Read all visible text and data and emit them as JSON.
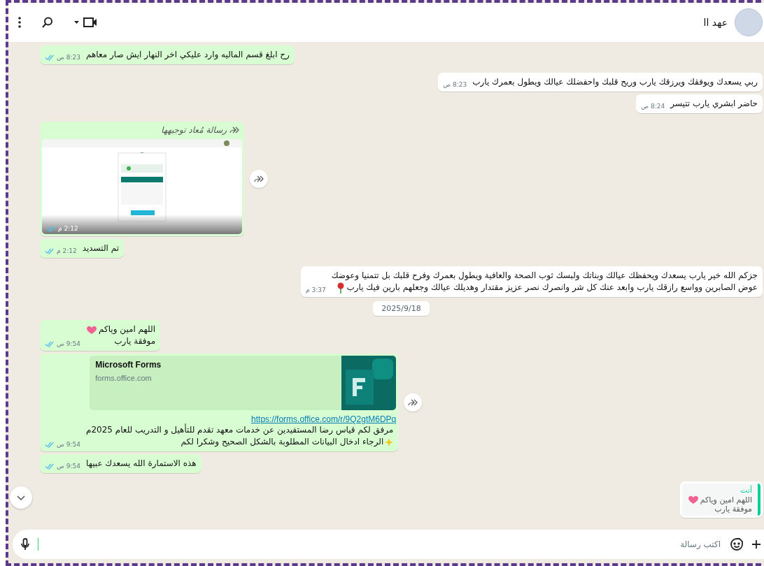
{
  "header": {
    "name": "عهد اا"
  },
  "messages": [
    {
      "kind": "text",
      "outgoing": true,
      "lines": [
        {
          "text": "رح ابلغ قسم الماليه وارد عليكي اخر النهار ايش صار معاهم"
        }
      ],
      "time": "8:23 ص",
      "read": true
    },
    {
      "kind": "text",
      "outgoing": false,
      "lines": [
        {
          "text": "ربي يسعدك ويوفقك ويرزقك يارب وريح قلبك واحفضلك عيالك ويطول بعمرك يارب"
        }
      ],
      "time": "8:23 ص"
    },
    {
      "kind": "text",
      "outgoing": false,
      "lines": [
        {
          "text": "حاضر ابشري يارب تتيسر"
        }
      ],
      "time": "8:24 ص"
    },
    {
      "kind": "image",
      "outgoing": true,
      "forwarded_label": "رسالة مُعاد توجيهها",
      "time": "2:12 م",
      "read": true
    },
    {
      "kind": "text",
      "outgoing": true,
      "lines": [
        {
          "text": "تم التسديد"
        }
      ],
      "time": "2:12 م",
      "read": true
    },
    {
      "kind": "text",
      "outgoing": false,
      "lines": [
        {
          "text": "جزكم الله خير يارب يسعدك ويحفظك عيالك وبناتك ولبسك ثوب الصحة والعافية ويطول بعمرك وفرح قلبك بل تتمنيا وعوضك"
        },
        {
          "text": "عوض الصابرين وواسع رازقك يارب وابعد عنك كل شر وانصرك نصر عزيز مقتدار وهديلك عيالك وجعلهم بارين فيك يارب",
          "emoji": {
            "kind": "rose"
          }
        }
      ],
      "time": "3:37 م"
    },
    {
      "kind": "date",
      "label": "2025/9/18"
    },
    {
      "kind": "text",
      "outgoing": true,
      "lines": [
        {
          "text": "اللهم امين وياكم",
          "emoji": {
            "kind": "heart"
          }
        },
        {
          "text": "موفقة يارب"
        }
      ],
      "time": "9:54 ص",
      "read": true
    },
    {
      "kind": "link",
      "outgoing": true,
      "preview_title": "Microsoft Forms",
      "preview_domain": "forms.office.com",
      "url": "https://forms.office.com/r/9Q2gtM6DPq",
      "lines": [
        {
          "text": "مرفق لكم قياس رضا المستفيدين عن خدمات معهد تقدم للتأهيل و التدريب للعام 2025م"
        },
        {
          "text": "الرجاء ادخال البيانات المطلوبة بالشكل الصحيح وشكرا لكم",
          "emoji": {
            "kind": "sparkle",
            "first": true
          }
        }
      ],
      "time": "9:54 ص",
      "read": true
    },
    {
      "kind": "text",
      "outgoing": true,
      "lines": [
        {
          "text": "هذه الاستمارة الله يسعدك عبيها"
        }
      ],
      "time": "9:54 ص",
      "read": true
    },
    {
      "kind": "reply",
      "outgoing": false,
      "quote_author": "أنت",
      "quote_lines": [
        {
          "text": "اللهم امين وياكم",
          "emoji": {
            "kind": "heart"
          }
        },
        {
          "text": "موفقة يارب"
        }
      ]
    }
  ],
  "composer": {
    "placeholder": "اكتب رسالة"
  }
}
